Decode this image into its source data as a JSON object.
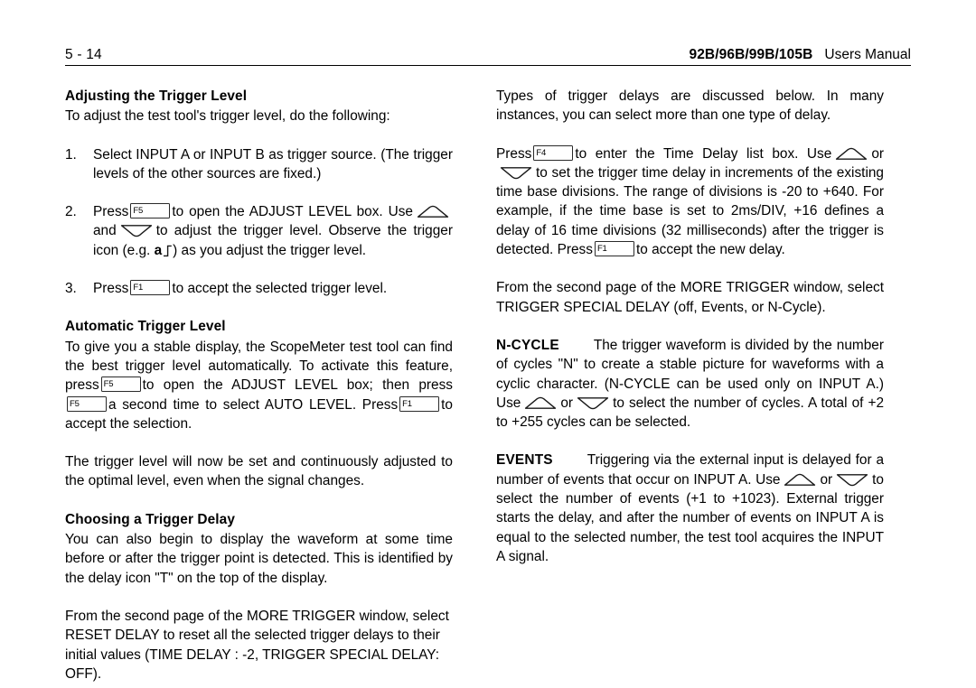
{
  "header": {
    "page_number": "5 - 14",
    "models": "92B/96B/99B/105B",
    "manual": "Users Manual"
  },
  "icons": {
    "key_f1": "F1",
    "key_f4": "F4",
    "key_f5": "F5",
    "arrow_up": "up-arrow-key-icon",
    "arrow_down": "down-arrow-key-icon",
    "trigger_a": "a",
    "trigger_edge": "rising-edge-icon"
  },
  "left_column": {
    "heading_1": "Adjusting the Trigger Level",
    "intro_1": "To adjust the test tool's trigger level, do the following:",
    "steps": [
      {
        "number": "1.",
        "text": "Select INPUT A or INPUT B as trigger source. (The trigger levels of the other sources are fixed.)"
      },
      {
        "number": "2.",
        "part_a": "Press",
        "part_b": "to open the ADJUST LEVEL box. Use",
        "part_c": "and",
        "part_d": "to adjust the trigger level. Observe the trigger icon (e.g.",
        "part_e": ") as you adjust the trigger level."
      },
      {
        "number": "3.",
        "part_a": "Press",
        "part_b": "to accept the selected trigger level."
      }
    ],
    "heading_2": "Automatic Trigger Level",
    "para_2_a": "To give you a stable display, the ScopeMeter test tool can find the best trigger level automatically. To activate this feature, press",
    "para_2_b": "to open the ADJUST LEVEL box; then press",
    "para_2_c": "a second time to select AUTO LEVEL. Press",
    "para_2_d": "to accept the selection.",
    "para_3": "The trigger level will now be set and continuously adjusted to the optimal level, even when the signal changes.",
    "heading_3": "Choosing a Trigger Delay",
    "para_4": "You can also begin to display the waveform at some time before or after the trigger point is detected. This is identified by the delay icon \"T\" on the top of the display.",
    "para_5": "From the second page of the MORE TRIGGER window, select RESET DELAY to reset all the selected trigger delays to their initial values (TIME DELAY : -2, TRIGGER SPECIAL DELAY: OFF)."
  },
  "right_column": {
    "para_1": "Types of trigger delays are discussed below. In many instances, you can select more than one type of delay.",
    "para_2_a": "Press",
    "para_2_b": "to enter the Time Delay list box. Use",
    "para_2_c": "or",
    "para_2_d": "to set the trigger time delay in increments of the existing time base divisions. The range of divisions is -20 to +640. For example, if the time base is set to 2ms/DIV, +16 defines a delay of 16 time divisions (32 milliseconds) after the trigger is detected. Press",
    "para_2_e": "to accept the new delay.",
    "para_3": "From the second page of the MORE TRIGGER window, select TRIGGER SPECIAL DELAY (off, Events, or N-Cycle).",
    "ncycle_label": "N-CYCLE",
    "ncycle_a": "The trigger waveform is divided by the number of cycles \"N\" to create a stable picture for waveforms with a cyclic character. (N-CYCLE can be used only on INPUT A.) Use",
    "ncycle_b": "or",
    "ncycle_c": "to select the number of cycles. A total of +2 to +255 cycles can be selected.",
    "events_label": "EVENTS",
    "events_a": "Triggering via the external input is delayed for a number of events that occur on INPUT A. Use",
    "events_b": "or",
    "events_c": "to select the number of events (+1 to +1023). External trigger starts the delay, and after the number of events on INPUT A is equal to the selected number, the test tool acquires the INPUT A signal."
  }
}
